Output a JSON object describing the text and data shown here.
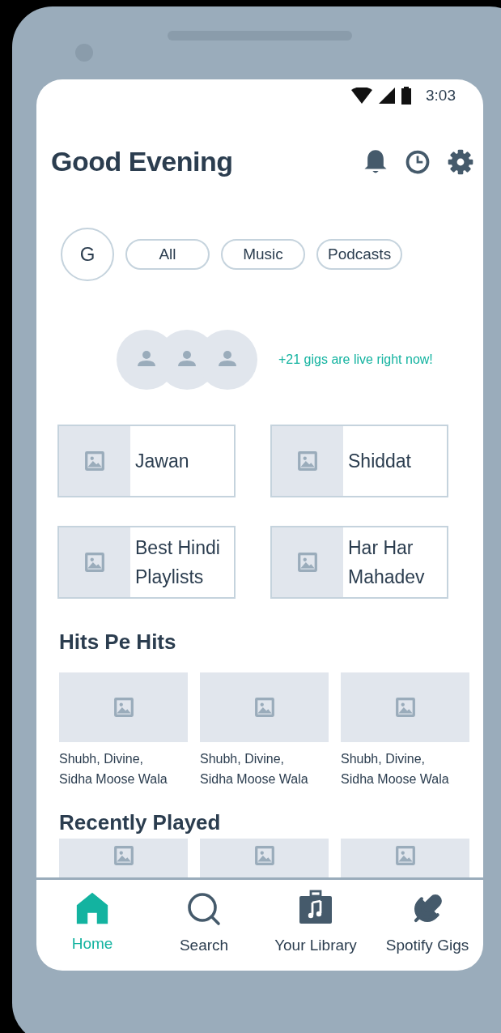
{
  "status_bar": {
    "time": "3:03"
  },
  "header": {
    "title": "Good Evening"
  },
  "filters": {
    "avatar": "G",
    "chips": [
      "All",
      "Music",
      "Podcasts"
    ]
  },
  "gigs_banner": {
    "text": "+21 gigs are live right now!"
  },
  "shortcuts": [
    {
      "title": "Jawan"
    },
    {
      "title": "Shiddat"
    },
    {
      "title": "Best Hindi Playlists"
    },
    {
      "title": "Har Har Mahadev"
    }
  ],
  "sections": [
    {
      "title": "Hits Pe Hits",
      "items": [
        {
          "caption": "Shubh, Divine, Sidha Moose Wala"
        },
        {
          "caption": "Shubh, Divine, Sidha Moose Wala"
        },
        {
          "caption": "Shubh, Divine, Sidha Moose Wala"
        }
      ]
    },
    {
      "title": "Recently Played",
      "items": [
        {
          "kind": "thumbnail"
        },
        {
          "kind": "thumbnail"
        },
        {
          "kind": "thumbnail"
        }
      ]
    }
  ],
  "nav": [
    {
      "kind": "home",
      "label": "Home",
      "selected": true
    },
    {
      "kind": "search",
      "label": "Search",
      "selected": false
    },
    {
      "kind": "library",
      "label": "Your Library",
      "selected": false
    },
    {
      "kind": "gigs",
      "label": "Spotify Gigs",
      "selected": false
    }
  ]
}
